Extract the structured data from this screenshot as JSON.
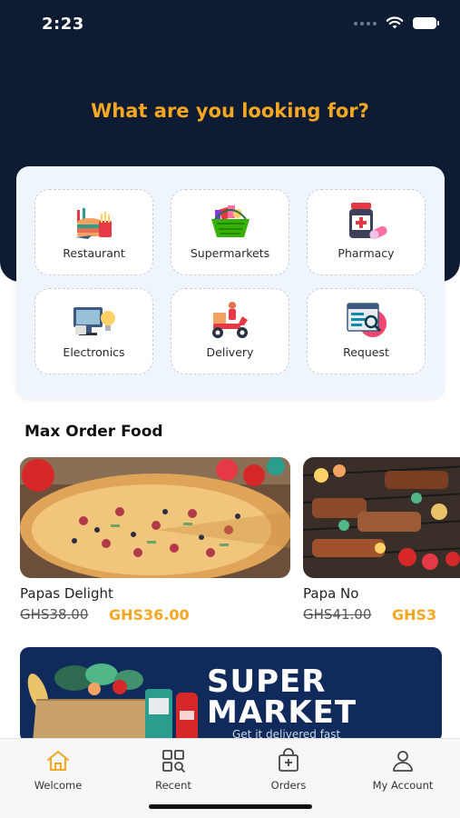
{
  "status_bar": {
    "time": "2:23"
  },
  "hero": {
    "title": "What are you looking for?"
  },
  "categories": [
    {
      "label": "Restaurant",
      "icon": "restaurant-icon"
    },
    {
      "label": "Supermarkets",
      "icon": "supermarket-basket-icon"
    },
    {
      "label": "Pharmacy",
      "icon": "pharmacy-icon"
    },
    {
      "label": "Electronics",
      "icon": "electronics-icon"
    },
    {
      "label": "Delivery",
      "icon": "delivery-scooter-icon"
    },
    {
      "label": "Request",
      "icon": "request-icon"
    }
  ],
  "section": {
    "title": "Max Order Food"
  },
  "foods": [
    {
      "name": "Papas Delight",
      "old_price": "GHS38.00",
      "new_price": "GHS36.00"
    },
    {
      "name": "Papa No",
      "old_price": "GHS41.00",
      "new_price": "GHS3"
    }
  ],
  "banner": {
    "line1": "SUPER",
    "line2": "MARKET",
    "subtitle": "Get it delivered fast"
  },
  "tabs": [
    {
      "label": "Welcome",
      "icon": "home-icon",
      "active": true
    },
    {
      "label": "Recent",
      "icon": "grid-search-icon",
      "active": false
    },
    {
      "label": "Orders",
      "icon": "orders-bag-icon",
      "active": false
    },
    {
      "label": "My Account",
      "icon": "user-icon",
      "active": false
    }
  ],
  "colors": {
    "navy": "#0d1b33",
    "accent": "#f5a623",
    "card_bg": "#eef5fd"
  }
}
